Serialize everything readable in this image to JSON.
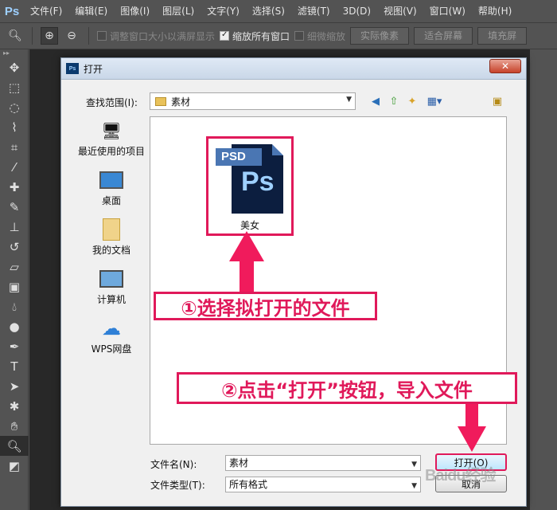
{
  "app": {
    "logo": "Ps"
  },
  "menu": [
    "文件(F)",
    "编辑(E)",
    "图像(I)",
    "图层(L)",
    "文字(Y)",
    "选择(S)",
    "滤镜(T)",
    "3D(D)",
    "视图(V)",
    "窗口(W)",
    "帮助(H)"
  ],
  "options": {
    "resize_windows": "调整窗口大小以满屏显示",
    "zoom_all": "缩放所有窗口",
    "scrubby_zoom": "细微缩放",
    "actual_pixels": "实际像素",
    "fit_screen": "适合屏幕",
    "fill_screen": "填充屏"
  },
  "dialog": {
    "title": "打开",
    "icon_text": "Ps",
    "close": "✕",
    "look_in_label": "查找范围(I):",
    "look_in_value": "素材",
    "places": [
      "最近使用的项目",
      "桌面",
      "我的文档",
      "计算机",
      "WPS网盘"
    ],
    "file": {
      "tag": "PSD",
      "logo": "Ps",
      "name": "美女"
    },
    "filename_label": "文件名(N):",
    "filename_value": "素材",
    "filetype_label": "文件类型(T):",
    "filetype_value": "所有格式",
    "open_button": "打开(O)",
    "cancel_button": "取消"
  },
  "annotations": {
    "step1": "①选择拟打开的文件",
    "step2": "②点击“打开”按钮，导入文件"
  },
  "watermark": "Baidu经验",
  "colors": {
    "accent": "#e0195a",
    "ps_blue": "#0c1e3f"
  }
}
